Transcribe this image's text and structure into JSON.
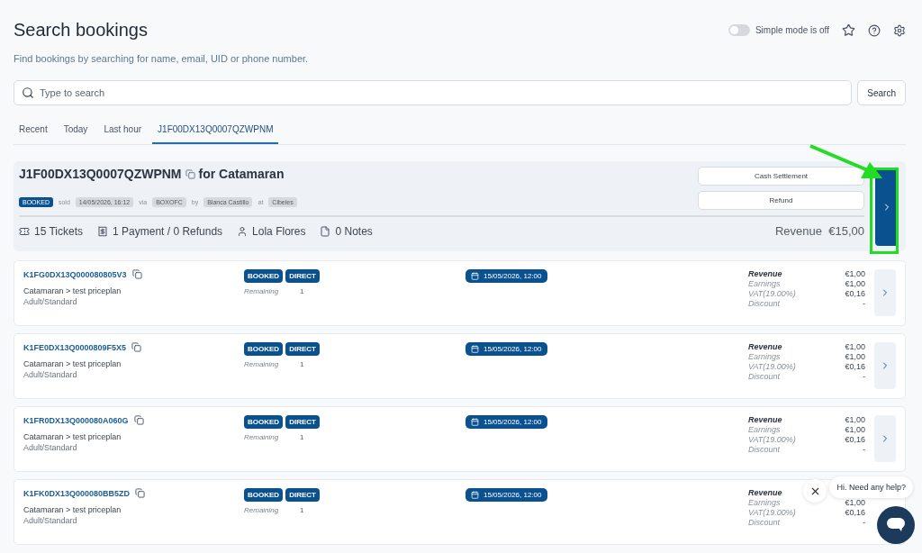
{
  "header": {
    "title": "Search bookings",
    "subtitle": "Find bookings by searching for name, email, UID or phone number.",
    "simple_mode": {
      "label": "Simple mode is off",
      "on": false
    }
  },
  "search": {
    "placeholder": "Type to search",
    "button": "Search"
  },
  "tabs": [
    {
      "label": "Recent",
      "selected": false
    },
    {
      "label": "Today",
      "selected": false
    },
    {
      "label": "Last hour",
      "selected": false
    },
    {
      "label": "J1F00DX13Q0007QZWPNM",
      "selected": true
    }
  ],
  "booking": {
    "code": "J1F00DX13Q0007QZWPNM",
    "for_text": "for Catamaran",
    "status": "BOOKED",
    "meta": [
      {
        "label": "sold",
        "value": "14/05/2026, 16:12"
      },
      {
        "label": "via",
        "value": "BOXOFC"
      },
      {
        "label": "by",
        "value": "Blanca Castillo"
      },
      {
        "label": "at",
        "value": "Cibeles"
      }
    ],
    "actions": [
      "Cash Settlement",
      "Refund"
    ],
    "stats": [
      {
        "kind": "ticket",
        "text": "15 Tickets"
      },
      {
        "kind": "payment",
        "text": "1 Payment / 0 Refunds"
      },
      {
        "kind": "person",
        "text": "Lola Flores"
      },
      {
        "kind": "note",
        "text": "0 Notes"
      }
    ],
    "revenue_label": "Revenue",
    "revenue_value": "€15,00"
  },
  "tickets": [
    {
      "code": "K1FG0DX13Q000080805V3",
      "product": "Catamaran > test priceplan",
      "variant": "Adult/Standard",
      "tags": [
        "BOOKED",
        "DIRECT"
      ],
      "remaining_label": "Remaining",
      "remaining": "1",
      "date": "15/05/2026, 12:00",
      "figures": [
        {
          "label": "Revenue",
          "value": "€1,00"
        },
        {
          "label": "Earnings",
          "value": "€1,00"
        },
        {
          "label": "VAT(19.00%)",
          "value": "€0,16"
        },
        {
          "label": "Discount",
          "value": "-"
        }
      ]
    },
    {
      "code": "K1FE0DX13Q0000809F5X5",
      "product": "Catamaran > test priceplan",
      "variant": "Adult/Standard",
      "tags": [
        "BOOKED",
        "DIRECT"
      ],
      "remaining_label": "Remaining",
      "remaining": "1",
      "date": "15/05/2026, 12:00",
      "figures": [
        {
          "label": "Revenue",
          "value": "€1,00"
        },
        {
          "label": "Earnings",
          "value": "€1,00"
        },
        {
          "label": "VAT(19.00%)",
          "value": "€0,16"
        },
        {
          "label": "Discount",
          "value": "-"
        }
      ]
    },
    {
      "code": "K1FR0DX13Q000080A060G",
      "product": "Catamaran > test priceplan",
      "variant": "Adult/Standard",
      "tags": [
        "BOOKED",
        "DIRECT"
      ],
      "remaining_label": "Remaining",
      "remaining": "1",
      "date": "15/05/2026, 12:00",
      "figures": [
        {
          "label": "Revenue",
          "value": "€1,00"
        },
        {
          "label": "Earnings",
          "value": "€1,00"
        },
        {
          "label": "VAT(19.00%)",
          "value": "€0,16"
        },
        {
          "label": "Discount",
          "value": "-"
        }
      ]
    },
    {
      "code": "K1FK0DX13Q000080BB5ZD",
      "product": "Catamaran > test priceplan",
      "variant": "Adult/Standard",
      "tags": [
        "BOOKED",
        "DIRECT"
      ],
      "remaining_label": "Remaining",
      "remaining": "1",
      "date": "15/05/2026, 12:00",
      "figures": [
        {
          "label": "Revenue"
        },
        {
          "label": "Earnings",
          "value": "€1,00"
        },
        {
          "label": "VAT(19.00%)",
          "value": "€0,16"
        },
        {
          "label": "Discount",
          "value": "-"
        }
      ]
    }
  ],
  "chat": {
    "greeting": "Hi. Need any help?"
  }
}
